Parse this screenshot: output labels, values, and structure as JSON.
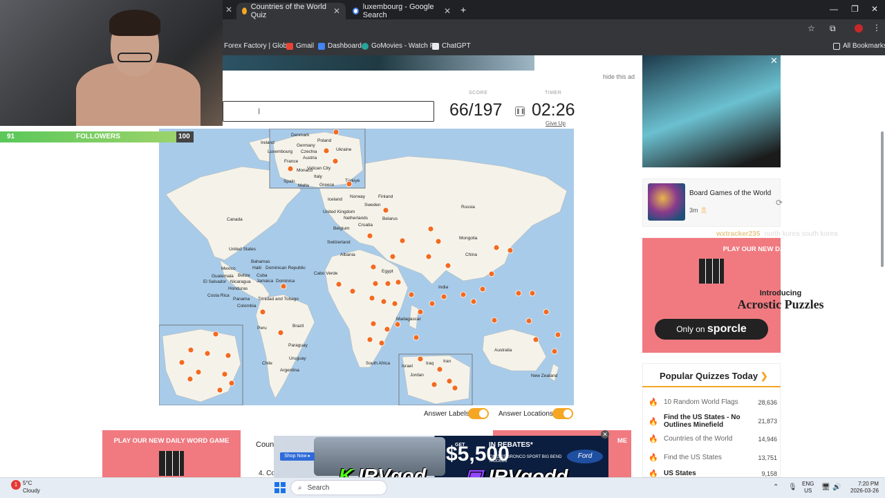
{
  "browser": {
    "tabs": [
      {
        "label": "Countries of the World Quiz",
        "active": true
      },
      {
        "label": "luxembourg - Google Search",
        "active": false
      }
    ],
    "bookmarks": [
      "Forex Factory | Glob...",
      "Gmail",
      "Dashboard",
      "GoMovies - Watch F...",
      "ChatGPT"
    ],
    "all_bookmarks": "All Bookmarks"
  },
  "stream": {
    "followers_label": "FOLLOWERS",
    "followers_current": "91",
    "followers_goal": "100",
    "followers_progress": 0.91,
    "handle_kick": "IRVgod",
    "handle_twitch": "IRVgodd",
    "chat": {
      "user": "wxtracker235",
      "message": "north korea south korea"
    }
  },
  "ads": {
    "hide_ad": "hide this ad",
    "sporcle_banner": "PLAY OUR NEW DAILY WORD GAME",
    "sporcle_introducing": "Introducing",
    "sporcle_product": "Acrostic Puzzles",
    "sporcle_only_on": "Only on",
    "sporcle_brand": "sporcle",
    "ford_price": "$5,500",
    "ford_rebate": "IN REBATES*",
    "ford_model": "ON 2025 BRONCO SPORT BIG BEND MODELS",
    "ford_get": "GET",
    "ford_logo": "Ford",
    "shop_now": "Shop Now ▸",
    "bottom_banner": "PLAY OUR NEW DAILY WORD GAME",
    "bottom_right_partial": "ME"
  },
  "quiz": {
    "input_value": "",
    "score_label": "SCORE",
    "score": "66/197",
    "timer_label": "TIMER",
    "timer": "02:26",
    "give_up": "Give Up",
    "answer_labels": "Answer Labels",
    "answer_locations": "Answer Locations"
  },
  "map_labels": {
    "denmark": "Denmark",
    "ireland": "Ireland",
    "luxembourg": "Luxembourg",
    "germany": "Germany",
    "poland": "Poland",
    "ukraine": "Ukraine",
    "czechia": "Czechia",
    "france": "France",
    "austria": "Austria",
    "monaco": "Monaco",
    "vatican": "Vatican City",
    "italy": "Italy",
    "spain": "Spain",
    "malta": "Malta",
    "greece": "Greece",
    "turkiye": "Türkiye",
    "iceland": "Iceland",
    "norway": "Norway",
    "finland": "Finland",
    "sweden": "Sweden",
    "uk": "United Kingdom",
    "netherlands": "Netherlands",
    "belarus": "Belarus",
    "belgium": "Belgium",
    "croatia": "Croatia",
    "russia": "Russia",
    "switzerland": "Switzerland",
    "mongolia": "Mongolia",
    "canada": "Canada",
    "albania": "Albania",
    "china": "China",
    "us": "United States",
    "bahamas": "Bahamas",
    "mexico": "Mexico",
    "haiti": "Haiti",
    "dominican_republic": "Dominican Republic",
    "cabo_verde": "Cabo Verde",
    "egypt": "Egypt",
    "guatemala": "Guatemala",
    "belize": "Belize",
    "cuba": "Cuba",
    "el_salvador": "El Salvador",
    "nicaragua": "Nicaragua",
    "jamaica": "Jamaica",
    "dominica": "Dominica",
    "india": "India",
    "honduras": "Honduras",
    "costa_rica": "Costa Rica",
    "panama": "Panama",
    "trinidad": "Trinidad and Tobago",
    "colombia": "Colombia",
    "madagascar": "Madagascar",
    "peru": "Peru",
    "brazil": "Brazil",
    "paraguay": "Paraguay",
    "australia": "Australia",
    "chile": "Chile",
    "uruguay": "Uruguay",
    "south_africa": "South Africa",
    "argentina": "Argentina",
    "new_zealand": "New Zealand",
    "israel": "Israel",
    "iraq": "Iraq",
    "iran": "Iran",
    "jordan": "Jordan"
  },
  "sidebar": {
    "recent_quiz": {
      "title": "Board Games of the World",
      "time": "3m"
    },
    "popular_title": "Popular Quizzes Today",
    "popular": [
      {
        "name": "10 Random World Flags",
        "count": "28,636",
        "bold": false
      },
      {
        "name": "Find the US States - No Outlines Minefield",
        "count": "21,873",
        "bold": true
      },
      {
        "name": "Countries of the World",
        "count": "14,946",
        "bold": false
      },
      {
        "name": "Find the US States",
        "count": "13,751",
        "bold": false
      },
      {
        "name": "US States",
        "count": "9,158",
        "bold": true
      }
    ]
  },
  "page_bottom": {
    "countries_partial": "Coun",
    "item_partial": "4. Co"
  },
  "taskbar": {
    "weather_temp": "5°C",
    "weather_condition": "Cloudy",
    "weather_badge": "1",
    "search": "Search",
    "lang": "ENG",
    "region": "US",
    "time": "7:20 PM",
    "date": "2026-03-26"
  },
  "colors": {
    "accent": "#f5a623",
    "pin": "#f26b21",
    "ocean": "#a8cbe9",
    "ad_pink": "#f07a80"
  }
}
